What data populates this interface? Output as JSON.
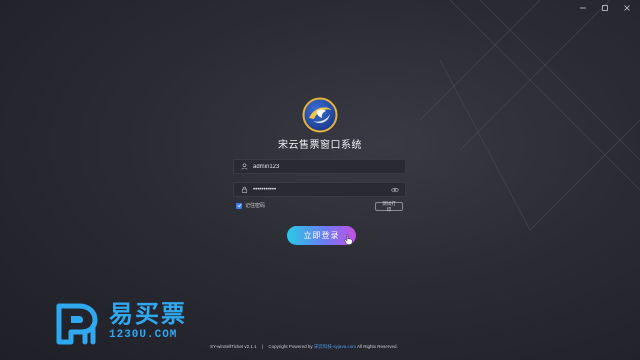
{
  "window": {
    "controls": [
      "minimize-icon",
      "maximize-icon",
      "close-icon"
    ]
  },
  "app": {
    "title": "宋云售票窗口系统"
  },
  "login": {
    "username_value": "admin123",
    "password_value": "•••••••••••",
    "remember_label": "记住密码",
    "remember_checked": true,
    "test_print_label": "测试打印",
    "submit_label": "立即登录"
  },
  "brand": {
    "name": "易买票",
    "url": "1230U.COM"
  },
  "footer": {
    "version": "SY-winSellTicket v2.1.1",
    "divider": "|",
    "copyright_prefix": "Copyright Powered by",
    "company_link": "宋云科技-syjava.com",
    "rights": "All Rights Reserved."
  },
  "colors": {
    "accent": "#3a7cf0",
    "brand": "#2fa8f0",
    "button_gradient_start": "#29c9e6",
    "button_gradient_end": "#c44fe6"
  }
}
